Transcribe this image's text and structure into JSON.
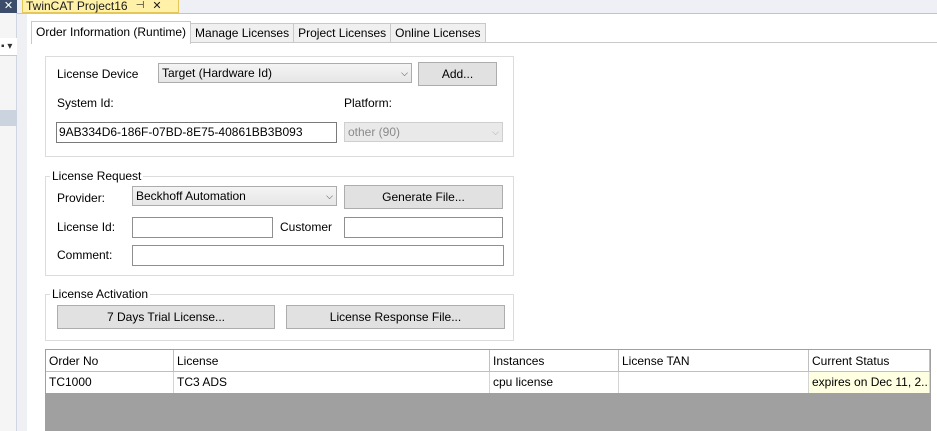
{
  "window": {
    "doc_tab_title": "TwinCAT Project16",
    "pin_icon": "pin-icon",
    "close_icon": "close-icon",
    "accent_color": "#fff1a8"
  },
  "tabs": [
    {
      "label": "Order Information (Runtime)",
      "active": true
    },
    {
      "label": "Manage Licenses",
      "active": false
    },
    {
      "label": "Project Licenses",
      "active": false
    },
    {
      "label": "Online Licenses",
      "active": false
    }
  ],
  "device": {
    "license_device_label": "License Device",
    "license_device_value": "Target (Hardware Id)",
    "add_button": "Add...",
    "system_id_label": "System Id:",
    "system_id_value": "9AB334D6-186F-07BD-8E75-40861BB3B093",
    "platform_label": "Platform:",
    "platform_value": "other (90)"
  },
  "request": {
    "title": "License Request",
    "provider_label": "Provider:",
    "provider_value": "Beckhoff Automation",
    "generate_button": "Generate File...",
    "license_id_label": "License Id:",
    "license_id_value": "",
    "customer_label": "Customer",
    "customer_value": "",
    "comment_label": "Comment:",
    "comment_value": ""
  },
  "activation": {
    "title": "License Activation",
    "trial_button": "7 Days Trial License...",
    "response_button": "License Response File..."
  },
  "table": {
    "columns": [
      "Order No",
      "License",
      "Instances",
      "License TAN",
      "Current Status"
    ],
    "rows": [
      [
        "TC1000",
        "TC3 ADS",
        "cpu license",
        "",
        "expires on Dec 11, 2..."
      ]
    ]
  }
}
